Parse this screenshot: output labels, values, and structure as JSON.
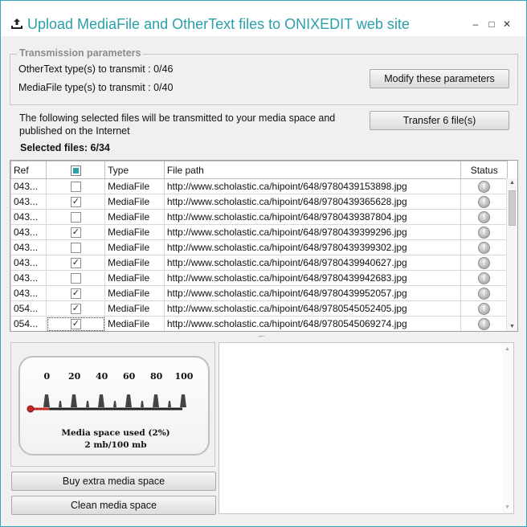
{
  "window": {
    "title": "Upload MediaFile and OtherText files to ONIXEDIT web site",
    "controls": {
      "minimize": "–",
      "maximize": "□",
      "close": "✕"
    }
  },
  "params": {
    "legend": "Transmission parameters",
    "othertext_label": "OtherText type(s) to transmit : 0/46",
    "mediafile_label": "MediaFile type(s) to transmit : 0/40",
    "modify_button": "Modify these parameters"
  },
  "info": {
    "note": "The following selected files will be transmitted to your media space and published on the Internet",
    "transfer_button": "Transfer 6 file(s)",
    "selected_count": "Selected files: 6/34"
  },
  "table": {
    "columns": {
      "ref": "Ref",
      "type": "Type",
      "path": "File path",
      "status": "Status"
    },
    "rows": [
      {
        "ref": "043...",
        "checked": false,
        "type": "MediaFile",
        "path": "http://www.scholastic.ca/hipoint/648/9780439153898.jpg",
        "status": "!"
      },
      {
        "ref": "043...",
        "checked": true,
        "type": "MediaFile",
        "path": "http://www.scholastic.ca/hipoint/648/9780439365628.jpg",
        "status": "!"
      },
      {
        "ref": "043...",
        "checked": false,
        "type": "MediaFile",
        "path": "http://www.scholastic.ca/hipoint/648/9780439387804.jpg",
        "status": "!"
      },
      {
        "ref": "043...",
        "checked": true,
        "type": "MediaFile",
        "path": "http://www.scholastic.ca/hipoint/648/9780439399296.jpg",
        "status": "!"
      },
      {
        "ref": "043...",
        "checked": false,
        "type": "MediaFile",
        "path": "http://www.scholastic.ca/hipoint/648/9780439399302.jpg",
        "status": "!"
      },
      {
        "ref": "043...",
        "checked": true,
        "type": "MediaFile",
        "path": "http://www.scholastic.ca/hipoint/648/9780439940627.jpg",
        "status": "!"
      },
      {
        "ref": "043...",
        "checked": false,
        "type": "MediaFile",
        "path": "http://www.scholastic.ca/hipoint/648/9780439942683.jpg",
        "status": "!"
      },
      {
        "ref": "043...",
        "checked": true,
        "type": "MediaFile",
        "path": "http://www.scholastic.ca/hipoint/648/9780439952057.jpg",
        "status": "!"
      },
      {
        "ref": "054...",
        "checked": true,
        "type": "MediaFile",
        "path": "http://www.scholastic.ca/hipoint/648/9780545052405.jpg",
        "status": "!"
      },
      {
        "ref": "054...",
        "checked": true,
        "type": "MediaFile",
        "path": "http://www.scholastic.ca/hipoint/648/9780545069274.jpg",
        "status": "!"
      }
    ]
  },
  "gauge": {
    "ticks": [
      "0",
      "20",
      "40",
      "60",
      "80",
      "100"
    ],
    "used_fraction": 0.02,
    "caption_line1": "Media space used (2%)",
    "caption_line2": "2 mb/100 mb",
    "needle_color": "#c62828"
  },
  "actions": {
    "buy_button": "Buy extra media space",
    "clean_button": "Clean media space"
  },
  "accent_color": "#2aa0aa"
}
